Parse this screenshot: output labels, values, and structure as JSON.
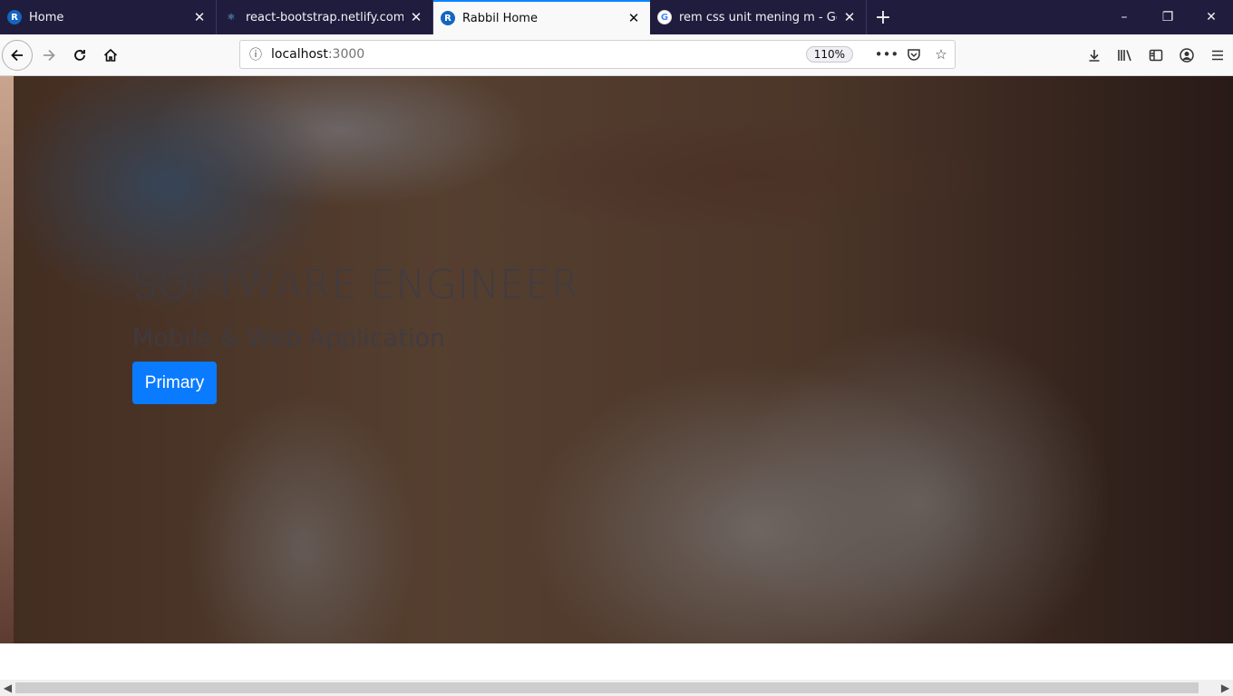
{
  "tabs": [
    {
      "title": "Home",
      "favicon": "rabbil-logo"
    },
    {
      "title": "react-bootstrap.netlify.com/con",
      "favicon": "react-bootstrap-logo"
    },
    {
      "title": "Rabbil Home",
      "favicon": "rabbil-logo",
      "active": true
    },
    {
      "title": "rem css unit mening m - Googl",
      "favicon": "google-logo"
    }
  ],
  "window_controls": {
    "minimize": "–",
    "restore": "❐",
    "close": "✕"
  },
  "address_bar": {
    "host": "localhost",
    "port": ":3000",
    "zoom": "110%"
  },
  "hero": {
    "title": "SOFTWARE ENGINEER",
    "subtitle": "Mobile & Web Application",
    "button_label": "Primary"
  },
  "colors": {
    "tab_strip": "#1f1c3d",
    "active_tab_accent": "#0a84ff",
    "primary_button": "#0a7bff"
  }
}
